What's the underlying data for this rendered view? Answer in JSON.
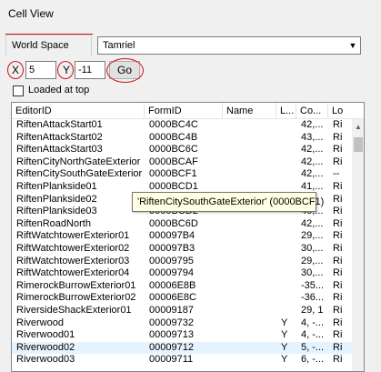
{
  "window": {
    "title": "Cell View"
  },
  "worldspace": {
    "tab_label": "World Space",
    "selected": "Tamriel"
  },
  "coords": {
    "x_label": "X",
    "x_value": "5",
    "y_label": "Y",
    "y_value": "-11",
    "go_label": "Go"
  },
  "loaded_at_top": {
    "label": "Loaded at top",
    "checked": false
  },
  "list": {
    "columns": [
      "EditorID",
      "FormID",
      "Name",
      "L...",
      "Co...",
      "Lo"
    ],
    "rows": [
      [
        "RiftenAttackStart01",
        "0000BC4C",
        "",
        "",
        "42,...",
        "Ri"
      ],
      [
        "RiftenAttackStart02",
        "0000BC4B",
        "",
        "",
        "43,...",
        "Ri"
      ],
      [
        "RiftenAttackStart03",
        "0000BC6C",
        "",
        "",
        "42,...",
        "Ri"
      ],
      [
        "RiftenCityNorthGateExterior",
        "0000BCAF",
        "",
        "",
        "42,...",
        "Ri"
      ],
      [
        "RiftenCitySouthGateExterior",
        "0000BCF1",
        "",
        "",
        "42,...",
        "--"
      ],
      [
        "RiftenPlankside01",
        "0000BCD1",
        "",
        "",
        "41,...",
        "Ri"
      ],
      [
        "RiftenPlankside02",
        "",
        "",
        "",
        "",
        "Ri"
      ],
      [
        "RiftenPlankside03",
        "0000BCD2",
        "",
        "",
        "40,...",
        "Ri"
      ],
      [
        "RiftenRoadNorth",
        "0000BC6D",
        "",
        "",
        "42,...",
        "Ri"
      ],
      [
        "RiftWatchtowerExterior01",
        "000097B4",
        "",
        "",
        "29,...",
        "Ri"
      ],
      [
        "RiftWatchtowerExterior02",
        "000097B3",
        "",
        "",
        "30,...",
        "Ri"
      ],
      [
        "RiftWatchtowerExterior03",
        "00009795",
        "",
        "",
        "29,...",
        "Ri"
      ],
      [
        "RiftWatchtowerExterior04",
        "00009794",
        "",
        "",
        "30,...",
        "Ri"
      ],
      [
        "RimerockBurrowExterior01",
        "00006E8B",
        "",
        "",
        "-35...",
        "Ri"
      ],
      [
        "RimerockBurrowExterior02",
        "00006E8C",
        "",
        "",
        "-36...",
        "Ri"
      ],
      [
        "RiversideShackExterior01",
        "00009187",
        "",
        "",
        "29, 1",
        "Ri"
      ],
      [
        "Riverwood",
        "00009732",
        "",
        "Y",
        "4, -...",
        "Ri"
      ],
      [
        "Riverwood01",
        "00009713",
        "",
        "Y",
        "4, -...",
        "Ri"
      ],
      [
        "Riverwood02",
        "00009712",
        "",
        "Y",
        "5, -...",
        "Ri"
      ],
      [
        "Riverwood03",
        "00009711",
        "",
        "Y",
        "6, -...",
        "Ri"
      ]
    ],
    "selected_row": 18
  },
  "tooltip": {
    "text": "'RiftenCitySouthGateExterior' (0000BCF1)"
  }
}
